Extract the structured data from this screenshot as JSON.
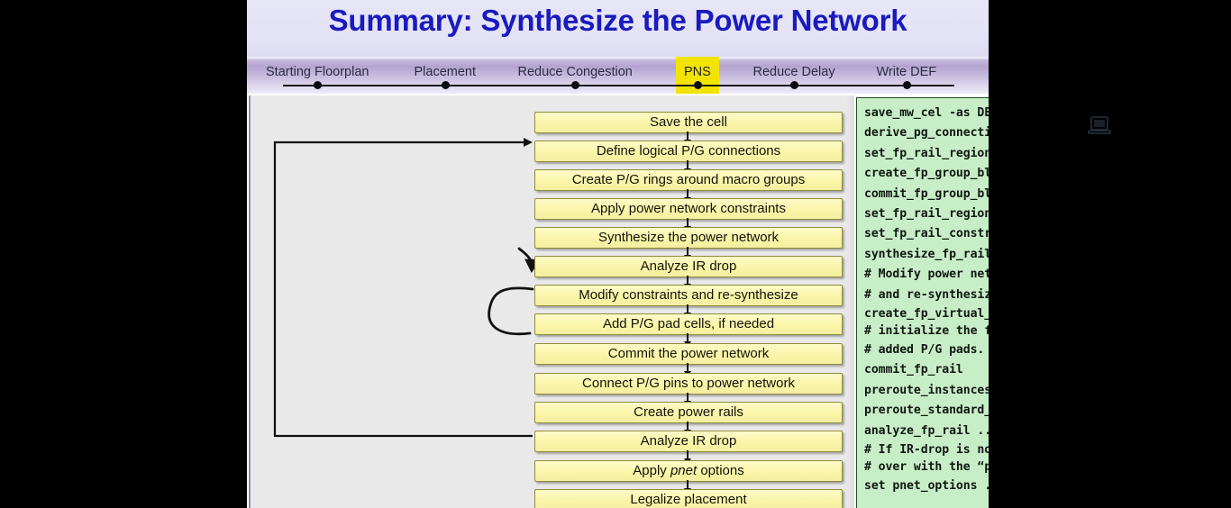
{
  "slide": {
    "title": "Summary: Synthesize the Power Network",
    "title_color": "#1a1ac0",
    "highlight_color": "#f2e400"
  },
  "nav": {
    "steps": [
      {
        "label": "Starting Floorplan",
        "active": false
      },
      {
        "label": "Placement",
        "active": false
      },
      {
        "label": "Reduce Congestion",
        "active": false
      },
      {
        "label": "PNS",
        "active": true
      },
      {
        "label": "Reduce Delay",
        "active": false
      },
      {
        "label": "Write DEF",
        "active": false
      }
    ]
  },
  "flow": {
    "boxes": [
      {
        "label": "Save the cell"
      },
      {
        "label": "Define logical P/G connections"
      },
      {
        "label": "Create P/G rings around macro groups"
      },
      {
        "label": "Apply power network constraints"
      },
      {
        "label": "Synthesize the power network"
      },
      {
        "label": "Analyze IR drop"
      },
      {
        "label": "Modify constraints and re-synthesize"
      },
      {
        "label": "Add P/G pad cells, if needed"
      },
      {
        "label": "Commit the power network"
      },
      {
        "label": "Connect P/G pins to power network"
      },
      {
        "label": "Create power rails"
      },
      {
        "label": "Analyze IR drop"
      },
      {
        "label": "Apply pnet options",
        "italic_word": "pnet"
      },
      {
        "label": "Legalize placement"
      }
    ]
  },
  "code": {
    "lines": [
      "save_mw_cel -as DESIGN_pre_pns",
      "derive_pg_connection ...",
      "set_fp_rail_region_constraints  ...",
      "create_fp_group_block_ring ...",
      "commit_fp_group_block_ring",
      "set_fp_rail_region_constraints -remove",
      "set_fp_rail_constraints ...",
      "synthesize_fp_rail ...",
      "# Modify power network constraints",
      "# and re-synthesize, as needed.",
      "create_fp_virtual_pad; # If needed, re-",
      "# initialize the floorplan with the",
      "# added P/G pads.",
      "commit_fp_rail",
      "preroute_instances",
      "preroute_standard_cells ...",
      "analyze_fp_rail ...",
      "# If IR-drop is not acceptable start",
      "# over with the “pre_pns” cell.",
      "set pnet_options ..."
    ]
  },
  "watermark": {
    "icon": "laptop-icon"
  }
}
